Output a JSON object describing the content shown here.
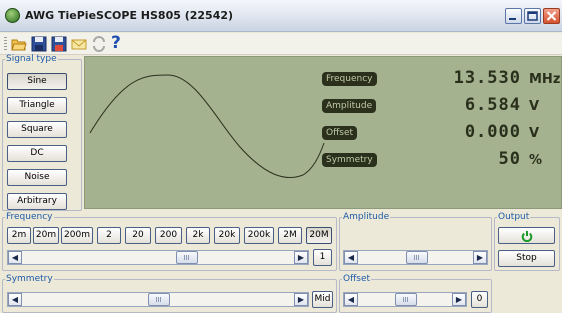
{
  "window": {
    "title": "AWG TiePieSCOPE HS805 (22542)",
    "app_icon": "awg-app-icon",
    "controls": [
      "minimize-icon",
      "maximize-icon",
      "close-icon"
    ]
  },
  "toolbar": {
    "icons": [
      "open-folder-icon",
      "save-icon",
      "save-as-icon",
      "email-icon",
      "refresh-icon",
      "help-icon"
    ],
    "help_glyph": "?"
  },
  "signal_type": {
    "legend": "Signal type",
    "options": [
      "Sine",
      "Triangle",
      "Square",
      "DC",
      "Noise",
      "Arbitrary"
    ],
    "selected": "Sine"
  },
  "display": {
    "readouts": [
      {
        "label": "Frequency",
        "value": "13.530",
        "unit": "MHz"
      },
      {
        "label": "Amplitude",
        "value": "6.584",
        "unit": "V"
      },
      {
        "label": "Offset",
        "value": "0.000",
        "unit": "V"
      },
      {
        "label": "Symmetry",
        "value": "50",
        "unit": "%"
      }
    ],
    "colors": {
      "background": "#a4b28f",
      "ink": "#2b301c"
    }
  },
  "frequency": {
    "legend": "Frequency",
    "ranges": [
      "2m",
      "20m",
      "200m",
      "2",
      "20",
      "200",
      "2k",
      "20k",
      "200k",
      "2M",
      "20M"
    ],
    "selected": "20M",
    "step_button": "1",
    "slider_position": 0.55
  },
  "amplitude": {
    "legend": "Amplitude",
    "slider_position": 0.5
  },
  "output": {
    "legend": "Output",
    "power_icon": "power-icon",
    "stop_label": "Stop"
  },
  "symmetry": {
    "legend": "Symmetry",
    "mid_button": "Mid",
    "slider_position": 0.5
  },
  "offset": {
    "legend": "Offset",
    "zero_button": "0",
    "slider_position": 0.5
  }
}
